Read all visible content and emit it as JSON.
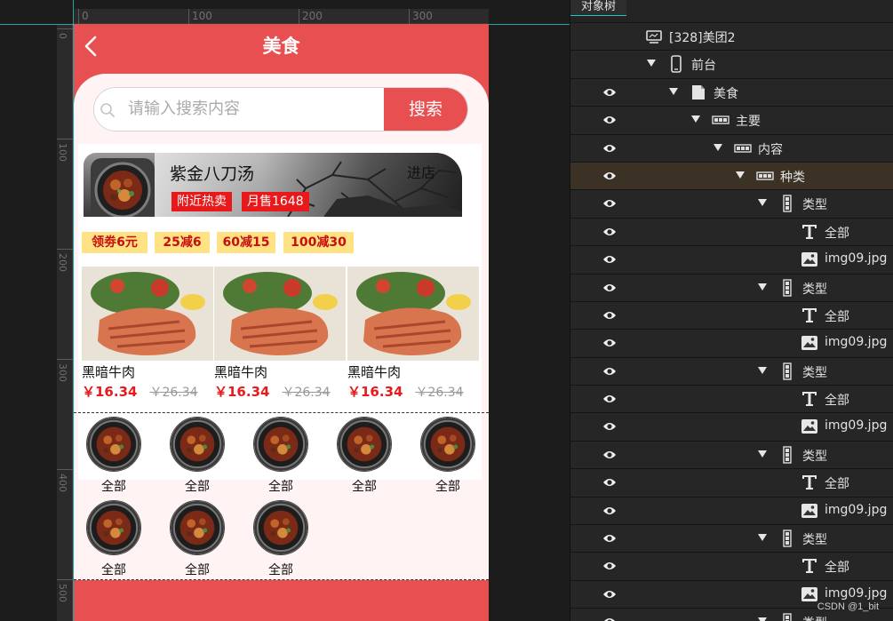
{
  "phone": {
    "title": "美食",
    "search_placeholder": "请输入搜索内容",
    "search_button": "搜索",
    "shop": {
      "name": "紫金八刀汤",
      "enter_label": "进店",
      "badges": [
        "附近热卖",
        "月售1648"
      ]
    },
    "coupons": [
      "领劵6元",
      "25减6",
      "60减15",
      "100减30"
    ],
    "products": [
      {
        "name": "黑暗牛肉",
        "price": "￥16.34",
        "old_price": "￥26.34"
      },
      {
        "name": "黑暗牛肉",
        "price": "￥16.34",
        "old_price": "￥26.34"
      },
      {
        "name": "黑暗牛肉",
        "price": "￥16.34",
        "old_price": "￥26.34"
      }
    ],
    "types": [
      "全部",
      "全部",
      "全部",
      "全部",
      "全部",
      "全部",
      "全部",
      "全部"
    ]
  },
  "rulers": {
    "horizontal": [
      "0",
      "100",
      "200",
      "300"
    ],
    "vertical": [
      "0",
      "100",
      "200",
      "300",
      "400",
      "500"
    ]
  },
  "panel": {
    "tab": "对象树",
    "tree": [
      {
        "label": "[328]美团2",
        "icon": "device-icon",
        "eye": false,
        "arrow": false,
        "indent": 0
      },
      {
        "label": "前台",
        "icon": "phone-icon",
        "eye": false,
        "arrow": true,
        "indent": 1
      },
      {
        "label": "美食",
        "icon": "page-icon",
        "eye": true,
        "arrow": true,
        "indent": 2
      },
      {
        "label": "主要",
        "icon": "container-icon",
        "eye": true,
        "arrow": true,
        "indent": 3
      },
      {
        "label": "内容",
        "icon": "container-icon",
        "eye": true,
        "arrow": true,
        "indent": 4
      },
      {
        "label": "种类",
        "icon": "container-icon",
        "eye": true,
        "arrow": true,
        "indent": 5,
        "selected": true
      },
      {
        "label": "类型",
        "icon": "column-icon",
        "eye": true,
        "arrow": true,
        "indent": 6
      },
      {
        "label": "全部",
        "icon": "text-icon",
        "eye": true,
        "arrow": false,
        "indent": 7
      },
      {
        "label": "img09.jpg",
        "icon": "image-icon",
        "eye": true,
        "arrow": false,
        "indent": 7
      },
      {
        "label": "类型",
        "icon": "column-icon",
        "eye": true,
        "arrow": true,
        "indent": 6
      },
      {
        "label": "全部",
        "icon": "text-icon",
        "eye": true,
        "arrow": false,
        "indent": 7
      },
      {
        "label": "img09.jpg",
        "icon": "image-icon",
        "eye": true,
        "arrow": false,
        "indent": 7
      },
      {
        "label": "类型",
        "icon": "column-icon",
        "eye": true,
        "arrow": true,
        "indent": 6
      },
      {
        "label": "全部",
        "icon": "text-icon",
        "eye": true,
        "arrow": false,
        "indent": 7
      },
      {
        "label": "img09.jpg",
        "icon": "image-icon",
        "eye": true,
        "arrow": false,
        "indent": 7
      },
      {
        "label": "类型",
        "icon": "column-icon",
        "eye": true,
        "arrow": true,
        "indent": 6
      },
      {
        "label": "全部",
        "icon": "text-icon",
        "eye": true,
        "arrow": false,
        "indent": 7
      },
      {
        "label": "img09.jpg",
        "icon": "image-icon",
        "eye": true,
        "arrow": false,
        "indent": 7
      },
      {
        "label": "类型",
        "icon": "column-icon",
        "eye": true,
        "arrow": true,
        "indent": 6
      },
      {
        "label": "全部",
        "icon": "text-icon",
        "eye": true,
        "arrow": false,
        "indent": 7
      },
      {
        "label": "img09.jpg",
        "icon": "image-icon",
        "eye": true,
        "arrow": false,
        "indent": 7
      },
      {
        "label": "类型",
        "icon": "column-icon",
        "eye": true,
        "arrow": true,
        "indent": 6
      }
    ]
  },
  "watermark": "CSDN @1_bit",
  "colors": {
    "brand_red": "#e84f51",
    "coupon_bg": "#ffe284",
    "price_red": "#e8191b",
    "selected_row": "#3b3225"
  }
}
